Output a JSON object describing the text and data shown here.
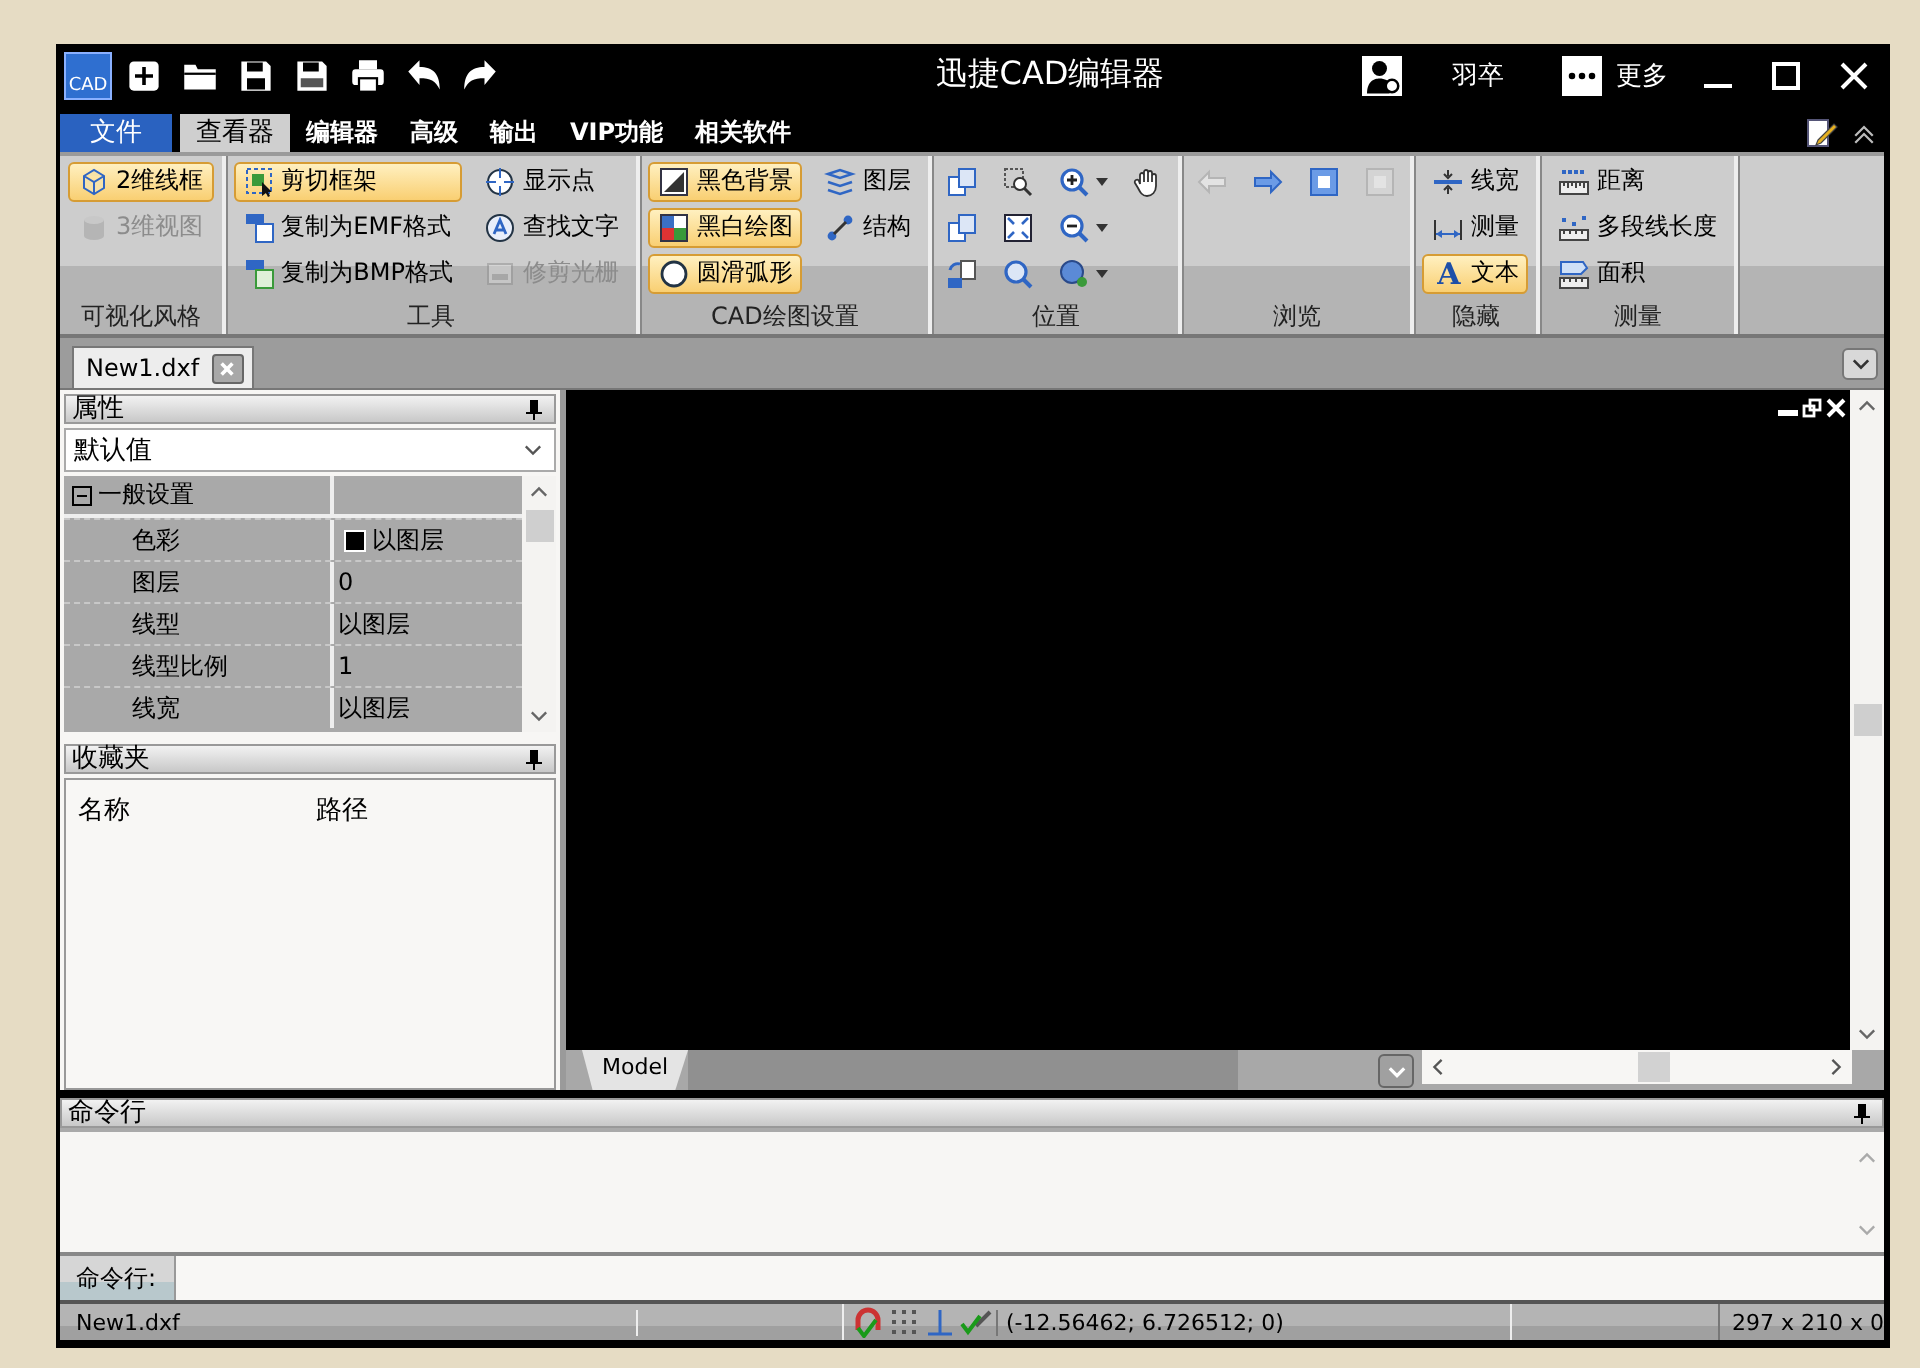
{
  "window": {
    "logo": "CAD",
    "title": "迅捷CAD编辑器",
    "user": "羽卒",
    "more": "更多"
  },
  "menu_tabs": [
    {
      "label": "文件",
      "kind": "file",
      "selected": false
    },
    {
      "label": "查看器",
      "kind": "tab",
      "selected": true
    },
    {
      "label": "编辑器",
      "kind": "tab",
      "selected": false
    },
    {
      "label": "高级",
      "kind": "tab",
      "selected": false
    },
    {
      "label": "输出",
      "kind": "tab",
      "selected": false
    },
    {
      "label": "VIP功能",
      "kind": "tab",
      "selected": false
    },
    {
      "label": "相关软件",
      "kind": "tab",
      "selected": false
    }
  ],
  "ribbon": [
    {
      "label": "可视化风格",
      "columns": [
        [
          {
            "label": "2维线框",
            "on": true,
            "disabled": false
          },
          {
            "label": "3维视图",
            "on": false,
            "disabled": true
          }
        ]
      ]
    },
    {
      "label": "工具",
      "columns": [
        [
          {
            "label": "剪切框架",
            "on": true,
            "disabled": false
          },
          {
            "label": "复制为EMF格式",
            "on": false,
            "disabled": false
          },
          {
            "label": "复制为BMP格式",
            "on": false,
            "disabled": false
          }
        ],
        [
          {
            "label": "显示点",
            "on": false,
            "disabled": false
          },
          {
            "label": "查找文字",
            "on": false,
            "disabled": false
          },
          {
            "label": "修剪光栅",
            "on": false,
            "disabled": true
          }
        ]
      ]
    },
    {
      "label": "CAD绘图设置",
      "columns": [
        [
          {
            "label": "黑色背景",
            "on": true,
            "disabled": false
          },
          {
            "label": "黑白绘图",
            "on": true,
            "disabled": false
          },
          {
            "label": "圆滑弧形",
            "on": true,
            "disabled": false
          }
        ],
        [
          {
            "label": "图层",
            "on": false,
            "disabled": false
          },
          {
            "label": "结构",
            "on": false,
            "disabled": false
          }
        ]
      ]
    },
    {
      "label": "位置",
      "columns": [
        [
          {
            "on": false,
            "disabled": false
          },
          {
            "on": false,
            "disabled": false
          },
          {
            "on": false,
            "disabled": false
          }
        ],
        [
          {
            "on": false,
            "disabled": false
          },
          {
            "on": false,
            "disabled": false
          },
          {
            "on": false,
            "disabled": false
          }
        ],
        [
          {
            "on": false,
            "disabled": false
          },
          {
            "on": false,
            "disabled": false
          },
          {
            "on": false,
            "disabled": false
          }
        ],
        [
          {
            "on": false,
            "disabled": false
          }
        ]
      ]
    },
    {
      "label": "浏览",
      "columns": [
        [
          {
            "on": false,
            "disabled": true
          }
        ],
        [
          {
            "on": false,
            "disabled": false
          }
        ],
        [
          {
            "on": false,
            "disabled": false
          }
        ],
        [
          {
            "on": false,
            "disabled": true
          }
        ]
      ]
    },
    {
      "label": "隐藏",
      "columns": [
        [
          {
            "label": "线宽",
            "on": false,
            "disabled": false
          },
          {
            "label": "测量",
            "on": false,
            "disabled": false
          },
          {
            "label": "文本",
            "glyph": "A",
            "on": true,
            "disabled": false
          }
        ]
      ]
    },
    {
      "label": "测量",
      "columns": [
        [
          {
            "label": "距离",
            "on": false,
            "disabled": false
          },
          {
            "label": "多段线长度",
            "on": false,
            "disabled": false
          },
          {
            "label": "面积",
            "on": false,
            "disabled": false
          }
        ]
      ]
    }
  ],
  "document_tabs": [
    {
      "label": "New1.dxf",
      "selected": true
    }
  ],
  "properties": {
    "title": "属性",
    "selector": "默认值",
    "section": {
      "label": "一般设置",
      "expanded": true
    },
    "rows": [
      {
        "name": "色彩",
        "value": "以图层",
        "kind": "color"
      },
      {
        "name": "图层",
        "value": "0",
        "kind": "text"
      },
      {
        "name": "线型",
        "value": "以图层",
        "kind": "text"
      },
      {
        "name": "线型比例",
        "value": "1",
        "kind": "text"
      },
      {
        "name": "线宽",
        "value": "以图层",
        "kind": "text"
      }
    ]
  },
  "favorites": {
    "title": "收藏夹",
    "columns": [
      "名称",
      "路径"
    ]
  },
  "layout_tabs": [
    {
      "label": "Model",
      "selected": true
    }
  ],
  "command": {
    "title": "命令行",
    "prompt": "命令行:"
  },
  "status_bar": {
    "file": "New1.dxf",
    "coordinates": "(-12.56462; 6.726512; 0)",
    "paper_size": "297 x 210 x 0"
  }
}
